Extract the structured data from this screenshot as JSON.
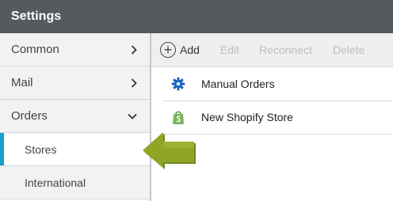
{
  "window": {
    "title": "Settings"
  },
  "sidebar": {
    "items": [
      {
        "label": "Common",
        "chevron_icon": "chevron-right-icon"
      },
      {
        "label": "Mail",
        "chevron_icon": "chevron-right-icon"
      },
      {
        "label": "Orders",
        "chevron_icon": "chevron-down-icon"
      }
    ],
    "subitems": [
      {
        "label": "Stores",
        "active": true
      },
      {
        "label": "International",
        "active": false
      }
    ]
  },
  "toolbar": {
    "add_label": "Add",
    "edit_label": "Edit",
    "reconnect_label": "Reconnect",
    "delete_label": "Delete"
  },
  "stores": [
    {
      "name": "Manual Orders",
      "icon": "gear-icon"
    },
    {
      "name": "New Shopify Store",
      "icon": "shopify-bag-icon"
    }
  ],
  "colors": {
    "titlebar": "#555a5e",
    "active_indicator": "#1aa0c8",
    "gear": "#1565c0",
    "shopify": "#7ab55c",
    "pointer_arrow": "#8ea526"
  }
}
